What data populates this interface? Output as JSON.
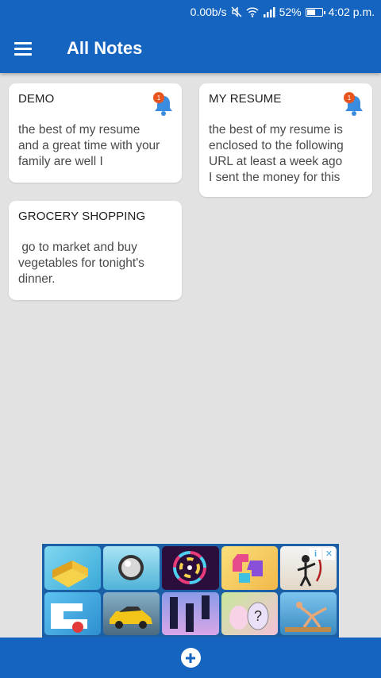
{
  "status_bar": {
    "network_speed": "0.00b/s",
    "battery_percent": "52%",
    "time": "4:02 p.m."
  },
  "app_bar": {
    "title": "All Notes"
  },
  "notes": [
    {
      "title": "DEMO",
      "body": "the best of my resume\nand a great time with your\nfamily are well I",
      "reminder_count": "1"
    },
    {
      "title": "MY RESUME",
      "body": "the best of my resume is\nenclosed to the following\nURL at least a week ago\nI sent the money for this",
      "reminder_count": "1"
    },
    {
      "title": "GROCERY SHOPPING",
      "body": " go to market and buy\nvegetables for tonight's\ndinner."
    }
  ],
  "ad": {
    "info_label": "i",
    "close_label": "✕"
  },
  "colors": {
    "primary": "#1565c0",
    "background": "#e2e2e2",
    "bell": "#3b8de0",
    "badge": "#e8541e"
  }
}
